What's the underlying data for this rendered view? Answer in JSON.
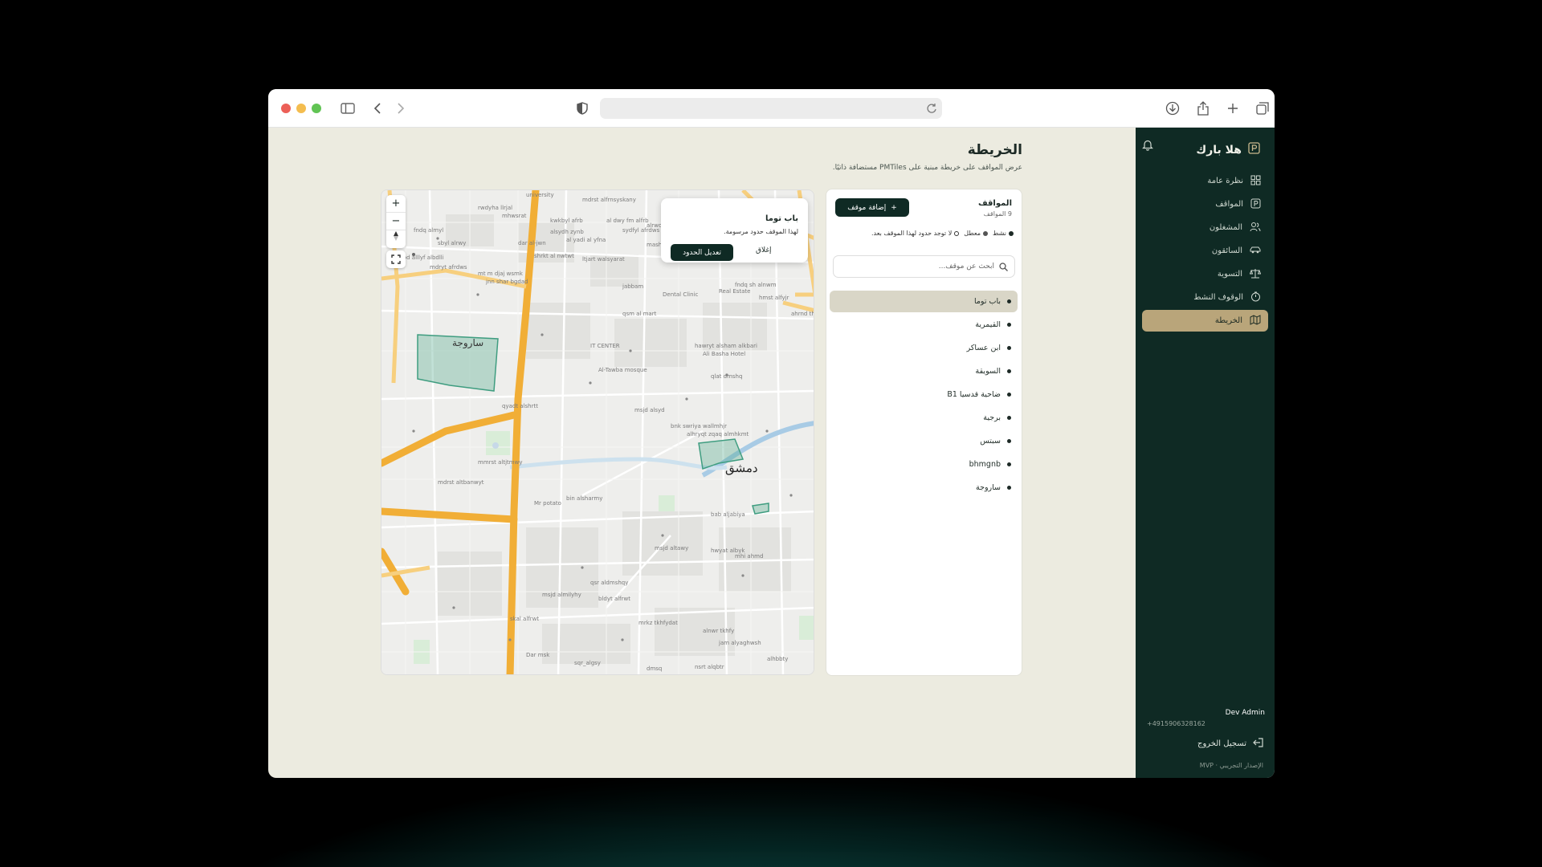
{
  "app": {
    "name": "هلا بارك"
  },
  "nav": [
    {
      "label": "نظرة عامة",
      "icon": "grid-icon"
    },
    {
      "label": "المواقف",
      "icon": "parking-icon"
    },
    {
      "label": "المشغلون",
      "icon": "users-icon"
    },
    {
      "label": "السائقون",
      "icon": "car-icon"
    },
    {
      "label": "التسوية",
      "icon": "scale-icon"
    },
    {
      "label": "الوقوف النشط",
      "icon": "timer-icon"
    },
    {
      "label": "الخريطة",
      "icon": "map-icon",
      "active": true
    }
  ],
  "user": {
    "name": "Dev Admin",
    "phone": "+4915906328162"
  },
  "logout_label": "تسجيل الخروج",
  "version": "الإصدار التجريبي · MVP",
  "page": {
    "title": "الخريطة",
    "subtitle": "عرض المواقف على خريطة مبنية على PMTiles مستضافة ذاتيًا."
  },
  "panel": {
    "title": "المواقف",
    "count": "9 المواقف",
    "add_label": "إضافة موقف",
    "legend": {
      "active": "نشط",
      "disabled": "معطل",
      "no_bounds": "لا توجد حدود لهذا الموقف بعد."
    },
    "search_placeholder": "ابحث عن موقف...",
    "items": [
      "باب توما",
      "القيمرية",
      "ابن عساكر",
      "السويقة",
      "ضاحية قدسيا B1",
      "برجية",
      "سبتس",
      "bhmgnb",
      "ساروجة"
    ]
  },
  "popup": {
    "title": "باب توما",
    "desc": "لهذا الموقف حدود مرسومة.",
    "edit_label": "تعديل الحدود",
    "close_label": "إغلاق"
  },
  "map": {
    "zoom_in": "+",
    "zoom_out": "−",
    "city": "دمشق",
    "district": "ساروجة",
    "labels": [
      "university",
      "mdrst alfrnsyskany",
      "rwdyha llrjal",
      "mhwsrat",
      "kwkbyl afrb",
      "al dwy fm alfrb",
      "alrwdiya",
      "fndq almyl",
      "alsydh zynb",
      "sydfyl afrdws",
      "sbyl alrwy",
      "dar al-jwn",
      "al yadi al yfna",
      "mashady alyafy",
      "d bd alllyf albdlli",
      "shrkt al nwtwt",
      "ltjart walsyarat",
      "mdryt afrdws",
      "mt m djaj wsmk",
      "jnn shar bgdad",
      "jabbam",
      "Dental Clinic",
      "Real Estate",
      "fndq sh alnwm",
      "hmst alfyjr",
      "ahrnd th",
      "qsm al mart",
      "IT CENTER",
      "Al-Tawba mosque",
      "hawryt alsham alkbari",
      "Ali Basha Hotel",
      "qlat dmshq",
      "qyadt alshrtt",
      "msjd alsyd",
      "bnk swriya wallmhjr",
      "alhryqt zqaq almhkmt",
      "mmrst altjtmwy",
      "mdrst altbanwyt",
      "Mr potato",
      "bin alsharmy",
      "bab aljabiya",
      "msjd altawy",
      "hwyat albyk",
      "mhi ahmd",
      "qsr aldmshqy",
      "msjd almilyhy",
      "bldyt alfrwt",
      "skal alfrwt",
      "mrkz tkhfydat",
      "alnwr tkhfy",
      "jam alyaghwsh",
      "Dar msk",
      "sqr_algsy",
      "nsrt alqbtr",
      "alhbbty",
      "dmsq"
    ]
  }
}
